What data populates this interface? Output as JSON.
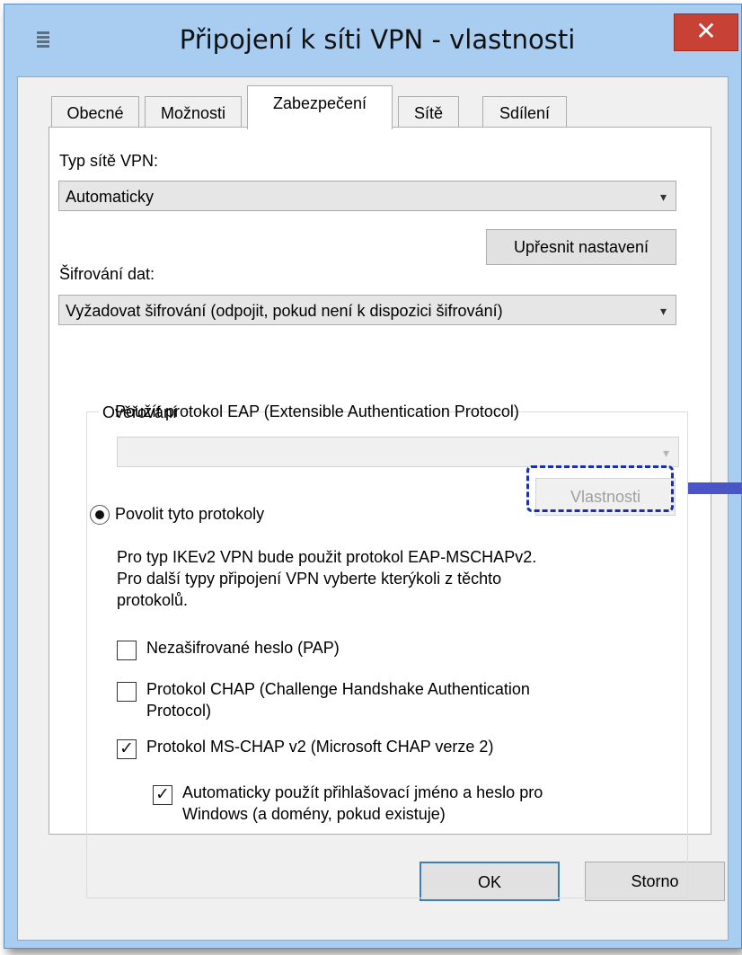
{
  "window": {
    "title": "Připojení k síti VPN - vlastnosti",
    "close_glyph": "✕"
  },
  "tabs": [
    {
      "label": "Obecné"
    },
    {
      "label": "Možnosti"
    },
    {
      "label": "Zabezpečení",
      "active": true
    },
    {
      "label": "Sítě"
    },
    {
      "label": "Sdílení"
    }
  ],
  "vpn_type": {
    "label": "Typ sítě VPN:",
    "value": "Automaticky"
  },
  "advanced_button": "Upřesnit nastavení",
  "encryption": {
    "label": "Šifrování dat:",
    "value": "Vyžadovat šifrování (odpojit, pokud není k dispozici šifrování)"
  },
  "auth": {
    "legend": "Ověřování",
    "eap_radio": {
      "label": "Použít protokol EAP (Extensible Authentication Protocol)",
      "selected": false
    },
    "eap_combo_value": "",
    "properties_button": "Vlastnosti",
    "allow_radio": {
      "label": "Povolit tyto protokoly",
      "selected": true
    },
    "description": [
      "Pro typ IKEv2 VPN bude použit protokol EAP-MSCHAPv2.",
      "Pro další typy připojení VPN vyberte kterýkoli z těchto",
      "protokolů."
    ],
    "pap": {
      "label": "Nezašifrované heslo (PAP)",
      "checked": false
    },
    "chap": {
      "label_line1": "Protokol CHAP (Challenge Handshake Authentication",
      "label_line2": "Protocol)",
      "checked": false
    },
    "mschap": {
      "label": "Protokol MS-CHAP v2 (Microsoft CHAP verze 2)",
      "checked": true
    },
    "auto_login": {
      "label_line1": "Automaticky použít přihlašovací jméno a heslo pro",
      "label_line2": "Windows (a domény, pokud existuje)",
      "checked": true
    }
  },
  "footer": {
    "ok": "OK",
    "cancel": "Storno"
  },
  "icons": {
    "dropdown": "▾",
    "check": "✓"
  },
  "colors": {
    "frame": "#a9cdf0",
    "close": "#c74135",
    "focus_ring": "#1a2fb4"
  }
}
